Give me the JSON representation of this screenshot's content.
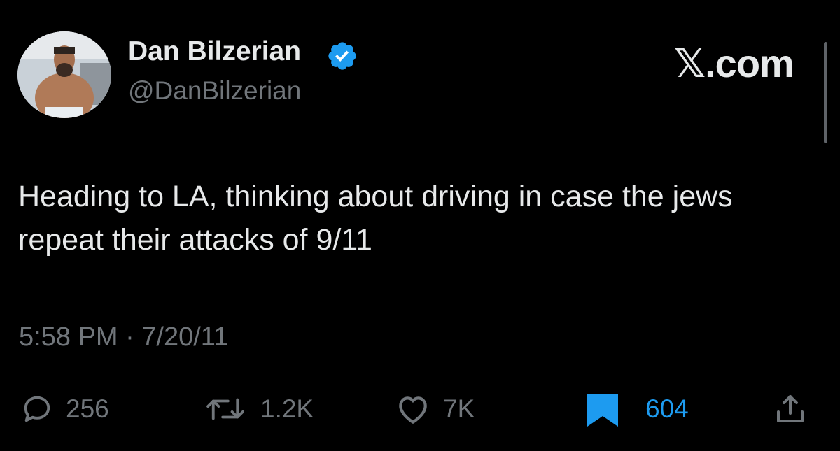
{
  "user": {
    "display_name": "Dan Bilzerian",
    "handle": "@DanBilzerian",
    "verified": true,
    "verified_color": "#1d9bf0"
  },
  "brand": {
    "label": "𝕏.com"
  },
  "tweet": {
    "text": "Heading to LA, thinking about driving in case the jews repeat their attacks of 9/11",
    "timestamp": "5:58 PM · 7/20/11"
  },
  "actions": {
    "replies": {
      "count": "256",
      "icon": "reply-icon"
    },
    "retweets": {
      "count": "1.2K",
      "icon": "retweet-icon"
    },
    "likes": {
      "count": "7K",
      "icon": "heart-icon"
    },
    "bookmarks": {
      "count": "604",
      "icon": "bookmark-filled-icon",
      "active": true
    },
    "share": {
      "icon": "share-icon"
    }
  },
  "colors": {
    "background": "#000000",
    "text": "#e7e9ea",
    "muted": "#71767b",
    "accent": "#1d9bf0"
  }
}
